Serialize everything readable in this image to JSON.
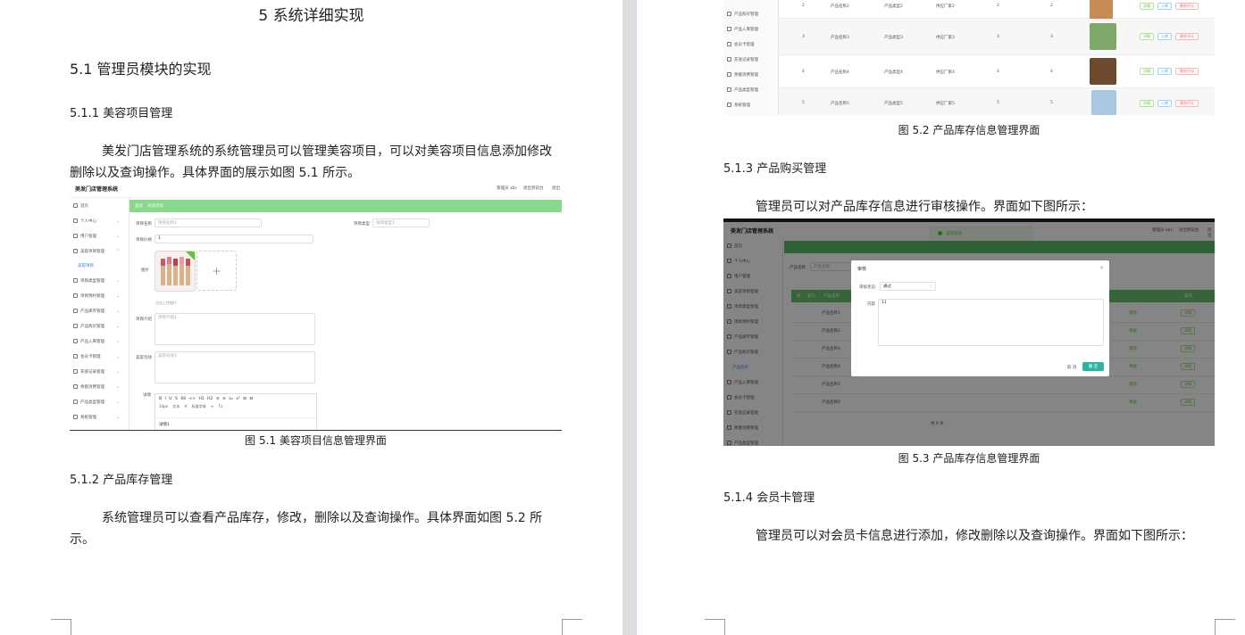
{
  "left_page": {
    "chapter_title": "5 系统详细实现",
    "section_title": "5.1  管理员模块的实现",
    "sub1_title": "5.1.1  美容项目管理",
    "sub1_para": "美发门店管理系统的系统管理员可以管理美容项目，可以对美容项目信息添加修改删除以及查询操作。具体界面的展示如图 5.1 所示。",
    "fig1_caption": "图 5.1  美容项目信息管理界面",
    "sub2_title": "5.1.2  产品库存管理",
    "sub2_para": "系统管理员可以查看产品库存，修改，删除以及查询操作。具体界面如图 5.2 所示。"
  },
  "right_page": {
    "fig2_caption": "图 5.2  产品库存信息管理界面",
    "sub3_title": "5.1.3  产品购买管理",
    "sub3_para": "管理员可以对产品库存信息进行审核操作。界面如下图所示：",
    "fig3_caption": "图 5.3  产品库存信息管理界面",
    "sub4_title": "5.1.4  会员卡管理",
    "sub4_para": "管理员可以对会员卡信息进行添加，修改删除以及查询操作。界面如下图所示："
  },
  "fig1": {
    "app_title": "美发门店管理系统",
    "header_links": [
      "管理员 abc",
      "退出到前台",
      "退出"
    ],
    "breadcrumb": [
      "首页",
      "美容项目"
    ],
    "sidebar": [
      "首页",
      "个人中心",
      "用户管理",
      "美容项目管理",
      "美容项目",
      "项目类型管理",
      "项目预约管理",
      "产品库存管理",
      "产品购买管理",
      "产品入库管理",
      "会员卡管理",
      "充值记录管理",
      "余额消费管理",
      "产品类型管理",
      "系统管理"
    ],
    "labels": {
      "name": "项目名称",
      "type": "项目类型",
      "price": "项目价格",
      "image": "图片",
      "intro": "项目介绍",
      "effect": "美容功效",
      "detail": "详情"
    },
    "placeholders": {
      "name": "项目名称1",
      "type": "项目类型1",
      "price": "1",
      "intro": "项目介绍1",
      "effect": "美容功效1",
      "detail": "详情1"
    },
    "upload_hint": "点击上传图片",
    "upload_plus": "+",
    "editor_toolbar": [
      "B",
      "I",
      "U",
      "S",
      "66",
      "<>",
      "H1",
      "H2",
      "≡",
      "≡",
      "x₂",
      "x²",
      "⊟",
      "⊟"
    ],
    "editor_toolbar2": [
      "14px",
      "文本",
      "A",
      "标准字体",
      "≡",
      "Tx"
    ]
  },
  "fig2": {
    "sidebar": [
      "产品购买管理",
      "产品入库管理",
      "会员卡管理",
      "充值记录管理",
      "余额消费管理",
      "产品类型管理",
      "系统管理"
    ],
    "rows": [
      {
        "no": "2",
        "name": "产品名称2",
        "type": "产品类型2",
        "maker": "供应厂家2",
        "a": "2",
        "b": "2"
      },
      {
        "no": "3",
        "name": "产品名称3",
        "type": "产品类型3",
        "maker": "供应厂家3",
        "a": "3",
        "b": "3"
      },
      {
        "no": "4",
        "name": "产品名称4",
        "type": "产品类型4",
        "maker": "供应厂家4",
        "a": "4",
        "b": "4"
      },
      {
        "no": "5",
        "name": "产品名称5",
        "type": "产品类型5",
        "maker": "供应厂家5",
        "a": "5",
        "b": "5"
      }
    ],
    "actions": [
      "详情",
      "入库",
      "删除评论"
    ]
  },
  "fig3": {
    "app_title": "美发门店管理系统",
    "header_links": [
      "管理员 abc",
      "退出到前台",
      "退出"
    ],
    "toast": "操作成功",
    "sidebar": [
      "首页",
      "个人中心",
      "用户管理",
      "美容项目管理",
      "项目类型管理",
      "项目预约管理",
      "产品库存管理",
      "产品购买管理",
      "产品购买",
      "产品入库管理",
      "会员卡管理",
      "充值记录管理",
      "余额消费管理",
      "产品类型管理"
    ],
    "search_label": "产品名称",
    "search_placeholder": "产品名称",
    "table_head": [
      "索",
      "索引",
      "产品名称",
      "操作"
    ],
    "rows": [
      "产品名称1",
      "产品名称2",
      "产品名称3",
      "产品名称4",
      "产品名称5",
      "产品名称6"
    ],
    "row_action": "详情",
    "row_tag": "审核",
    "pagination": "共 6 条",
    "modal": {
      "title": "审核",
      "status_label": "审核状态",
      "status_value": "通过",
      "reply_label": "内容",
      "reply_value": "11",
      "cancel": "取 消",
      "confirm": "确 定"
    }
  }
}
